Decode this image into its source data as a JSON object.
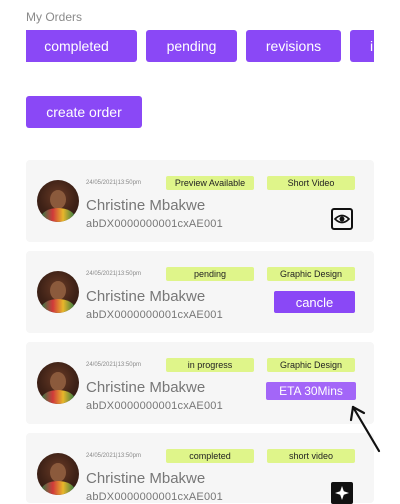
{
  "header": {
    "title": "My Orders"
  },
  "filters": [
    "completed",
    "pending",
    "revisions",
    "in progress"
  ],
  "create_button": "create order",
  "orders": [
    {
      "timestamp": "24/05/2021|13:50pm",
      "status": "Preview Available",
      "service": "Short Video",
      "name": "Christine Mbakwe",
      "code": "abDX0000000001cxAE001",
      "action": {
        "type": "icon",
        "icon": "eye-icon"
      }
    },
    {
      "timestamp": "24/05/2021|13:50pm",
      "status": "pending",
      "service": "Graphic Design",
      "name": "Christine Mbakwe",
      "code": "abDX0000000001cxAE001",
      "action": {
        "type": "button",
        "label": "cancle"
      }
    },
    {
      "timestamp": "24/05/2021|13:50pm",
      "status": "in progress",
      "service": "Graphic Design",
      "name": "Christine Mbakwe",
      "code": "abDX0000000001cxAE001",
      "action": {
        "type": "eta",
        "label": "ETA 30Mins"
      }
    },
    {
      "timestamp": "24/05/2021|13:50pm",
      "status": "completed",
      "service": "short video",
      "name": "Christine Mbakwe",
      "code": "abDX0000000001cxAE001",
      "action": {
        "type": "icon",
        "icon": "sparkle-icon"
      }
    }
  ],
  "colors": {
    "accent": "#8a48f6",
    "tag": "#dff58a",
    "card": "#f6f6f6"
  },
  "annotation": {
    "icon": "arrow-icon"
  }
}
